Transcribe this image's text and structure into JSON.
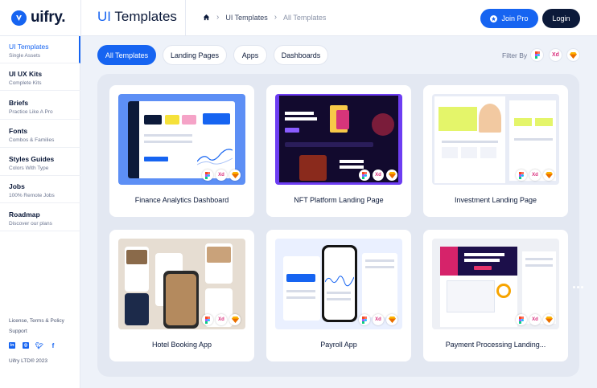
{
  "header": {
    "logo": "uifry.",
    "title_accent": "UI",
    "title_rest": " Templates",
    "breadcrumb": {
      "home_icon": "home-icon",
      "item1": "UI Templates",
      "item2": "All Templates"
    },
    "join_label": "Join Pro",
    "login_label": "Login"
  },
  "sidebar": {
    "items": [
      {
        "title": "UI Templates",
        "subtitle": "Single Assets"
      },
      {
        "title": "UI UX Kits",
        "subtitle": "Complete Kits"
      },
      {
        "title": "Briefs",
        "subtitle": "Practice Like A Pro"
      },
      {
        "title": "Fonts",
        "subtitle": "Combos & Families"
      },
      {
        "title": "Styles Guides",
        "subtitle": "Colors With Type"
      },
      {
        "title": "Jobs",
        "subtitle": "100% Remote Jobs"
      },
      {
        "title": "Roadmap",
        "subtitle": "Discover our plans"
      }
    ],
    "footer": {
      "legal": "License, Terms & Policy",
      "support": "Support",
      "copyright": "Uifry LTD® 2023"
    }
  },
  "filters": {
    "chips": [
      "All Templates",
      "Landing Pages",
      "Apps",
      "Dashboards"
    ],
    "label": "Filter By",
    "xd": "Xd"
  },
  "cards": [
    {
      "title": "Finance Analytics Dashboard"
    },
    {
      "title": "NFT Platform Landing Page"
    },
    {
      "title": "Investment Landing Page"
    },
    {
      "title": "Hotel Booking App"
    },
    {
      "title": "Payroll App"
    },
    {
      "title": "Payment Processing Landing..."
    }
  ],
  "colors": {
    "accent": "#1664f1",
    "navy": "#0c1a3a"
  }
}
